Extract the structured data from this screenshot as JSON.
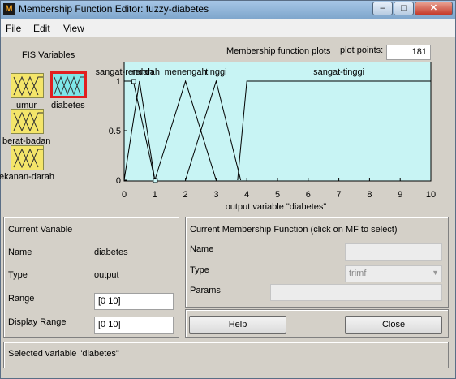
{
  "window": {
    "title": "Membership Function Editor: fuzzy-diabetes",
    "minimize": "–",
    "maximize": "□",
    "close": "✕"
  },
  "menu": [
    "File",
    "Edit",
    "View"
  ],
  "fis": {
    "label": "FIS Variables",
    "inputs": [
      "umur",
      "berat-badan",
      "tekanan-darah"
    ],
    "output": "diabetes",
    "selected": "diabetes"
  },
  "plot": {
    "title": "Membership function plots",
    "plot_points_label": "plot points:",
    "plot_points": "181"
  },
  "chart_data": {
    "type": "line",
    "xlabel": "output variable \"diabetes\"",
    "xlim": [
      0,
      10
    ],
    "ylim": [
      0,
      1
    ],
    "xticks": [
      "0",
      "1",
      "2",
      "3",
      "4",
      "5",
      "6",
      "7",
      "8",
      "9",
      "10"
    ],
    "yticks": [
      "0",
      "0.5",
      "1"
    ],
    "colors": {
      "background": "#c8f4f4",
      "curve": "#000000"
    },
    "series": [
      {
        "name": "sangat-rendah",
        "x": [
          0,
          0.3,
          1
        ],
        "y": [
          1,
          1,
          0
        ]
      },
      {
        "name": "rendah",
        "x": [
          0,
          0.5,
          1
        ],
        "y": [
          0,
          1,
          0
        ]
      },
      {
        "name": "menengah",
        "x": [
          1,
          2,
          3
        ],
        "y": [
          0,
          1,
          0
        ]
      },
      {
        "name": "tinggi",
        "x": [
          2,
          3,
          3.8
        ],
        "y": [
          0,
          1,
          0
        ]
      },
      {
        "name": "sangat-tinggi",
        "x": [
          3.7,
          4,
          10
        ],
        "y": [
          0,
          1,
          1
        ]
      }
    ]
  },
  "current_variable": {
    "header": "Current Variable",
    "name_label": "Name",
    "name_value": "diabetes",
    "type_label": "Type",
    "type_value": "output",
    "range_label": "Range",
    "range_value": "[0 10]",
    "display_range_label": "Display Range",
    "display_range_value": "[0 10]"
  },
  "current_mf": {
    "header": "Current Membership Function (click on MF to select)",
    "name_label": "Name",
    "name_value": "",
    "type_label": "Type",
    "type_value": "trimf",
    "params_label": "Params",
    "params_value": ""
  },
  "buttons": {
    "help": "Help",
    "close": "Close"
  },
  "status": "Selected variable \"diabetes\""
}
